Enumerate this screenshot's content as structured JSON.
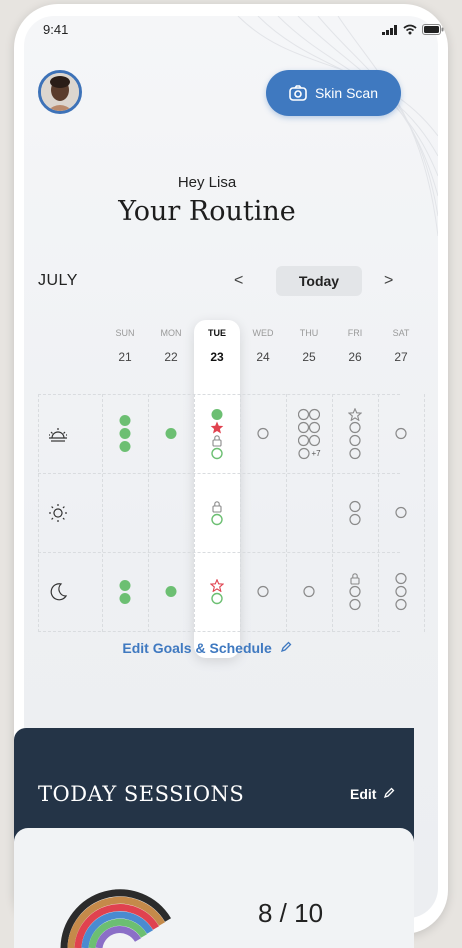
{
  "status": {
    "time": "9:41"
  },
  "header": {
    "scan_label": "Skin Scan"
  },
  "greeting": "Hey Lisa",
  "title": "Your Routine",
  "calendar": {
    "month": "JULY",
    "prev": "<",
    "today_label": "Today",
    "next": ">",
    "days": [
      {
        "name": "SUN",
        "num": "21"
      },
      {
        "name": "MON",
        "num": "22"
      },
      {
        "name": "TUE",
        "num": "23"
      },
      {
        "name": "WED",
        "num": "24"
      },
      {
        "name": "THU",
        "num": "25"
      },
      {
        "name": "FRI",
        "num": "26"
      },
      {
        "name": "SAT",
        "num": "27"
      }
    ],
    "selected_day": "TUE",
    "rows": [
      {
        "routine": "sunrise-icon",
        "cells": [
          [
            "dot-filled",
            "dot-filled",
            "dot-filled"
          ],
          [
            "dot-filled"
          ],
          [
            "dot-filled",
            "star-filled",
            "lock",
            "circle-green"
          ],
          [
            "circle"
          ],
          [
            "circle-pair",
            "circle-pair",
            "circle-pair",
            "circle-more"
          ],
          [
            "star-outline",
            "circle",
            "circle",
            "circle"
          ],
          [
            "circle"
          ]
        ]
      },
      {
        "routine": "sun-icon",
        "cells": [
          [],
          [],
          [
            "lock",
            "circle-green"
          ],
          [],
          [],
          [
            "circle",
            "circle"
          ],
          [
            "circle"
          ]
        ]
      },
      {
        "routine": "moon-icon",
        "cells": [
          [
            "dot-filled",
            "dot-filled"
          ],
          [
            "dot-filled"
          ],
          [
            "star-outline-red",
            "circle-green"
          ],
          [
            "circle"
          ],
          [
            "circle"
          ],
          [
            "lock",
            "circle",
            "circle"
          ],
          [
            "circle",
            "circle",
            "circle"
          ]
        ]
      }
    ],
    "more_count": "+7",
    "colors": {
      "filled": "#6cbf72",
      "star": "#e0424f",
      "outline": "#8a8a8a",
      "accent": "#3f79c0"
    }
  },
  "edit_goals_label": "Edit Goals & Schedule",
  "sessions": {
    "title": "TODAY SESSIONS",
    "edit_label": "Edit",
    "score": "8 / 10"
  }
}
